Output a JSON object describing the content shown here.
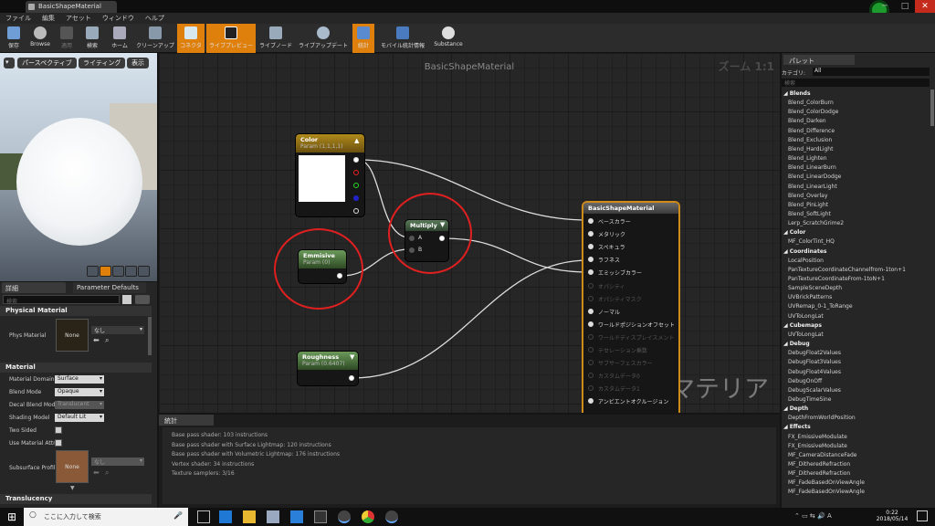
{
  "window": {
    "tab_title": "BasicShapeMaterial",
    "buttons": [
      "─",
      "□",
      "✕"
    ]
  },
  "menu": [
    "ファイル",
    "編集",
    "アセット",
    "ウィンドウ",
    "ヘルプ"
  ],
  "toolbar": [
    {
      "label": "保存",
      "icon": "save-icon",
      "active": false
    },
    {
      "label": "Browse",
      "icon": "browse-icon",
      "active": false
    },
    {
      "label": "適用",
      "icon": "apply-icon",
      "active": false
    },
    {
      "label": "検索",
      "icon": "search-icon",
      "active": false
    },
    {
      "label": "ホーム",
      "icon": "home-icon",
      "active": false
    },
    {
      "label": "クリーンアップ",
      "icon": "cleanup-icon",
      "active": false
    },
    {
      "label": "コネクタ",
      "icon": "connector-icon",
      "active": true
    },
    {
      "label": "ライブプレビュー",
      "icon": "live-preview-icon",
      "active": true
    },
    {
      "label": "ライブノード",
      "icon": "live-node-icon",
      "active": false
    },
    {
      "label": "ライブアップデート",
      "icon": "live-update-icon",
      "active": false
    },
    {
      "label": "統計",
      "icon": "stats-icon",
      "active": true
    },
    {
      "label": "モバイル統計情報",
      "icon": "mobile-stats-icon",
      "active": false
    },
    {
      "label": "Substance",
      "icon": "substance-icon",
      "active": false
    }
  ],
  "viewport": {
    "perspective": "パースペクティブ",
    "lighting": "ライティング",
    "show": "表示"
  },
  "details": {
    "tab": "詳細",
    "tab2": "Parameter Defaults",
    "search_placeholder": "検索",
    "physical_material_section": "Physical Material",
    "phys_material_label": "Phys Material",
    "phys_material_value": "なし",
    "none_thumb": "None",
    "material_section": "Material",
    "rows": [
      {
        "label": "Material Domain",
        "value": "Surface",
        "disabled": false
      },
      {
        "label": "Blend Mode",
        "value": "Opaque",
        "disabled": false
      },
      {
        "label": "Decal Blend Mode",
        "value": "Translucent",
        "disabled": true
      },
      {
        "label": "Shading Model",
        "value": "Default Lit",
        "disabled": false
      }
    ],
    "two_sided": "Two Sided",
    "use_material_attr": "Use Material Attri",
    "subsurface_label": "Subsurface Profil",
    "subsurface_value": "なし",
    "translucency_section": "Translucency"
  },
  "graph": {
    "title": "BasicShapeMaterial",
    "zoom": "ズーム 1:1",
    "watermark": "マテリアル",
    "nodes": {
      "color": {
        "title": "Color",
        "sub": "Param (1,1,1,1)"
      },
      "multiply": {
        "title": "Multiply",
        "a": "A",
        "b": "B"
      },
      "emmisive": {
        "title": "Emmisive",
        "sub": "Param (0)"
      },
      "roughness": {
        "title": "Roughness",
        "sub": "Param (0.6407)"
      },
      "result": {
        "title": "BasicShapeMaterial",
        "pins": [
          {
            "label": "ベースカラー",
            "active": true
          },
          {
            "label": "メタリック",
            "active": true
          },
          {
            "label": "スペキュラ",
            "active": true
          },
          {
            "label": "ラフネス",
            "active": true
          },
          {
            "label": "エミッシブカラー",
            "active": true
          },
          {
            "label": "オパシティ",
            "active": false
          },
          {
            "label": "オパシティマスク",
            "active": false
          },
          {
            "label": "ノーマル",
            "active": true
          },
          {
            "label": "ワールドポジションオフセット",
            "active": true
          },
          {
            "label": "ワールドディスプレイスメント",
            "active": false
          },
          {
            "label": "テセレーション乗数",
            "active": false
          },
          {
            "label": "サブサーフェスカラー",
            "active": false
          },
          {
            "label": "カスタムデータ0",
            "active": false
          },
          {
            "label": "カスタムデータ1",
            "active": false
          },
          {
            "label": "アンビエントオクルージョン",
            "active": true
          }
        ]
      }
    }
  },
  "stats": {
    "tab": "統計",
    "lines": [
      "Base pass shader: 103 instructions",
      "Base pass shader with Surface Lightmap: 120 instructions",
      "Base pass shader with Volumetric Lightmap: 176 instructions",
      "Vertex shader: 34 instructions",
      "Texture samplers: 3/16"
    ]
  },
  "palette": {
    "title": "パレット",
    "category_label": "カテゴリ:",
    "category_value": "All",
    "search_placeholder": "検索",
    "groups": [
      {
        "name": "Blends",
        "items": [
          "Blend_ColorBurn",
          "Blend_ColorDodge",
          "Blend_Darken",
          "Blend_Difference",
          "Blend_Exclusion",
          "Blend_HardLight",
          "Blend_Lighten",
          "Blend_LinearBurn",
          "Blend_LinearDodge",
          "Blend_LinearLight",
          "Blend_Overlay",
          "Blend_PinLight",
          "Blend_SoftLight",
          "Lerp_ScratchGrime2"
        ]
      },
      {
        "name": "Color",
        "items": [
          "MF_ColorTint_HQ"
        ]
      },
      {
        "name": "Coordinates",
        "items": [
          "LocalPosition",
          "PanTextureCoordinateChannelfrom-1ton+1",
          "PanTextureCoordinateFrom-1toN+1",
          "SampleSceneDepth",
          "UVBrickPatterns",
          "UVRemap_0-1_ToRange",
          "UVToLongLat"
        ]
      },
      {
        "name": "Cubemaps",
        "items": [
          "UVToLongLat"
        ]
      },
      {
        "name": "Debug",
        "items": [
          "DebugFloat2Values",
          "DebugFloat3Values",
          "DebugFloat4Values",
          "DebugOnOff",
          "DebugScalarValues",
          "DebugTimeSine"
        ]
      },
      {
        "name": "Depth",
        "items": [
          "DepthFromWorldPosition"
        ]
      },
      {
        "name": "Effects",
        "items": [
          "FX_EmissiveModulate",
          "FX_EmissiveModulate",
          "MF_CameraDistanceFade",
          "MF_DitheredRefraction",
          "MF_DitheredRefraction",
          "MF_FadeBasedOnViewAngle",
          "MF_FadeBasedOnViewAngle"
        ]
      }
    ]
  },
  "taskbar": {
    "search_placeholder": "ここに入力して検索",
    "time": "0:22",
    "date": "2018/05/14"
  }
}
